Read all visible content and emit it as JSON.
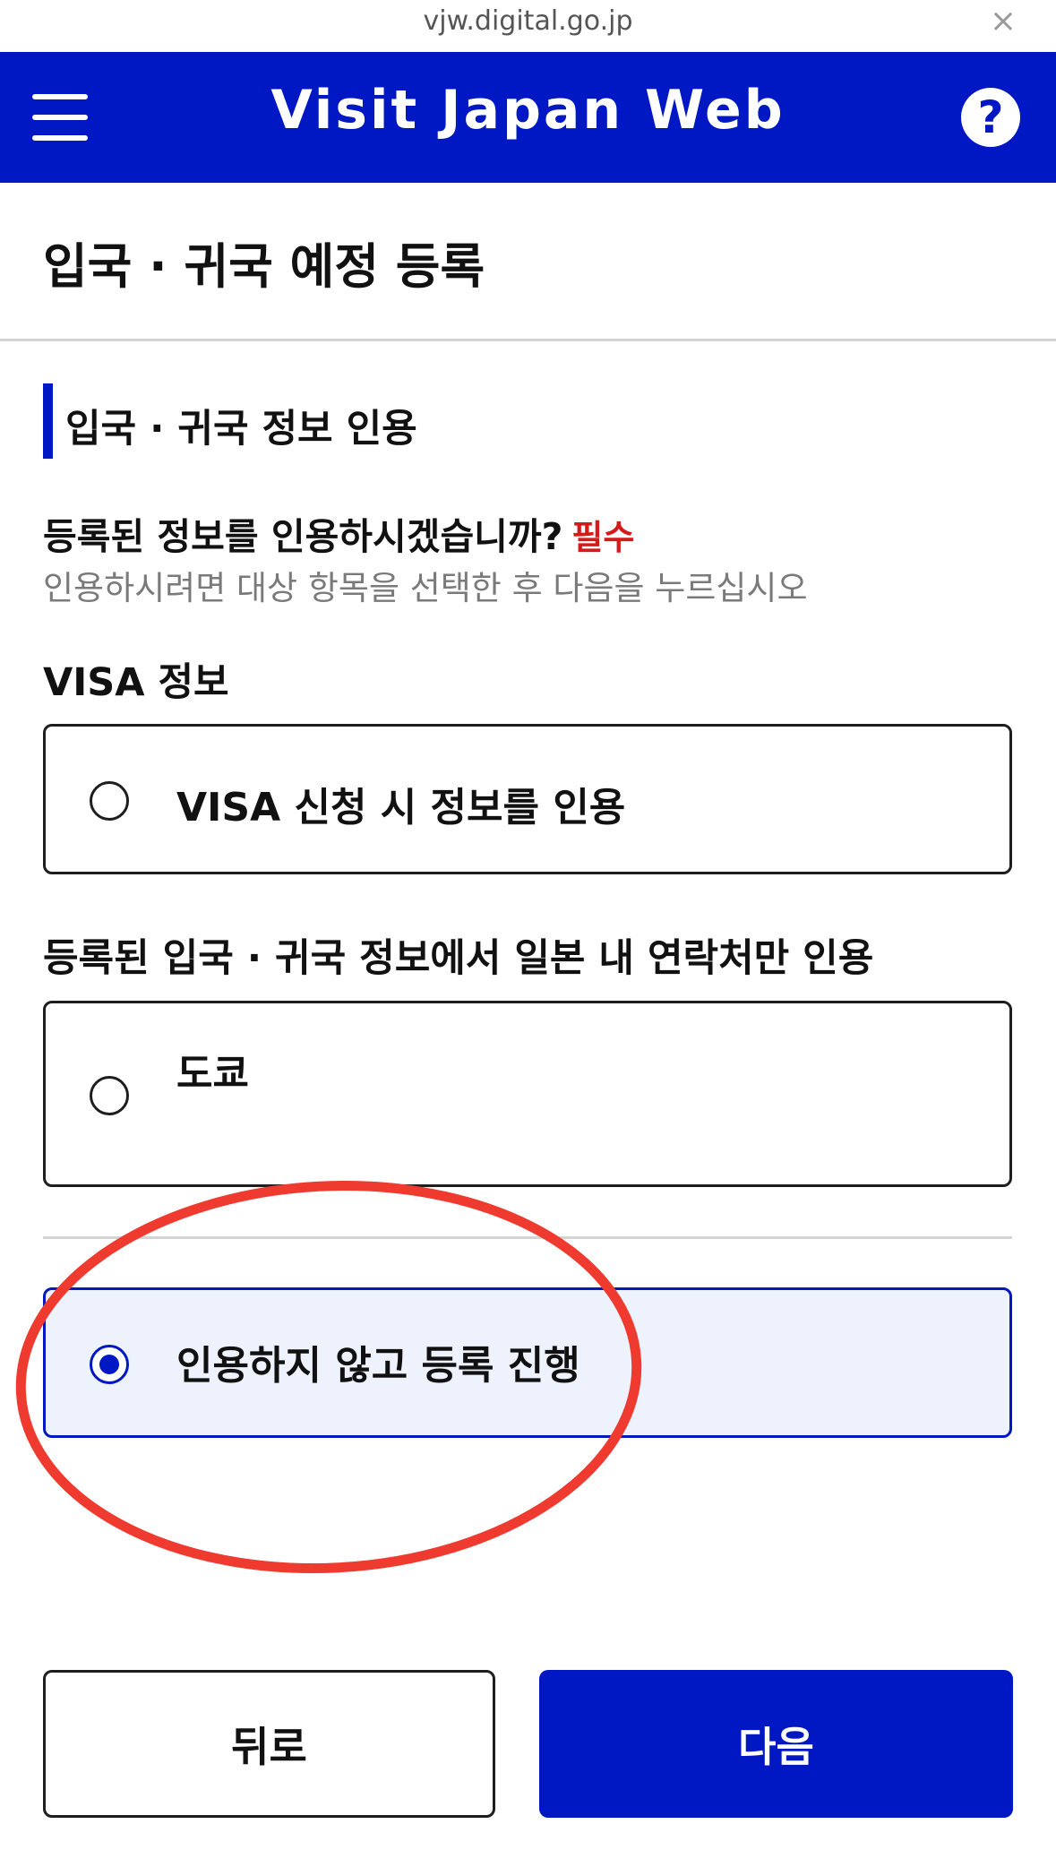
{
  "browser": {
    "url": "vjw.digital.go.jp",
    "close_icon": "×"
  },
  "header": {
    "menu_icon": "hamburger-icon",
    "title": "Visit Japan Web",
    "help_icon_glyph": "?",
    "brand_color": "#0018c4"
  },
  "page": {
    "title": "입국 · 귀국 예정 등록"
  },
  "section": {
    "title": "입국 · 귀국 정보 인용",
    "question": "등록된 정보를 인용하시겠습니까?",
    "required_label": "필수",
    "required_color": "#d61a1a",
    "hint": "인용하시려면 대상 항목을 선택한 후 다음을 누르십시오"
  },
  "groups": [
    {
      "label": "VISA 정보",
      "options": [
        {
          "label": "VISA 신청 시 정보를 인용",
          "selected": false
        }
      ]
    },
    {
      "label": "등록된 입국 · 귀국 정보에서 일본 내 연락처만 인용",
      "options": [
        {
          "label": "도쿄",
          "selected": false
        }
      ]
    }
  ],
  "no_quote_option": {
    "label": "인용하지 않고 등록 진행",
    "selected": true
  },
  "annotation": {
    "color": "#ee3a2f"
  },
  "buttons": {
    "back": "뒤로",
    "next": "다음"
  }
}
